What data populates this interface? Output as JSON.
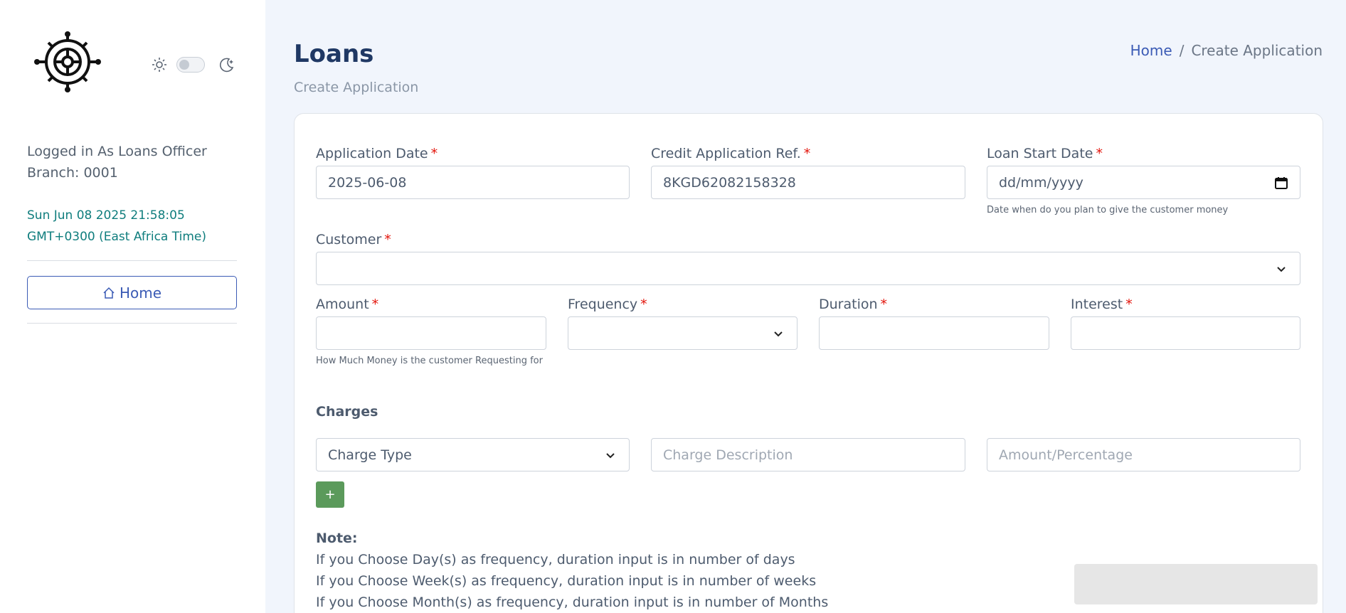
{
  "sidebar": {
    "user_line": "Logged in As Loans Officer",
    "branch_line": "Branch: 0001",
    "clock_line1": "Sun Jun 08 2025 21:58:05",
    "clock_line2": "GMT+0300 (East Africa Time)",
    "home_label": "Home",
    "icons": {
      "logo": "ship-wheel-logo",
      "sun": "sun-icon",
      "moon": "moon-icon",
      "home": "home-icon"
    },
    "theme_toggle": "off"
  },
  "header": {
    "title": "Loans",
    "subtitle": "Create Application",
    "breadcrumb": {
      "home": "Home",
      "separator": "/",
      "current": "Create Application"
    }
  },
  "form": {
    "application_date": {
      "label": "Application Date",
      "value": "2025-06-08"
    },
    "credit_ref": {
      "label": "Credit Application Ref.",
      "value": "8KGD62082158328"
    },
    "loan_start_date": {
      "label": "Loan Start Date",
      "placeholder": "dd/mm/yyyy",
      "hint": "Date when do you plan to give the customer money"
    },
    "customer": {
      "label": "Customer",
      "value": ""
    },
    "amount": {
      "label": "Amount",
      "value": "",
      "hint": "How Much Money is the customer Requesting for"
    },
    "frequency": {
      "label": "Frequency",
      "value": ""
    },
    "duration": {
      "label": "Duration",
      "value": ""
    },
    "interest": {
      "label": "Interest",
      "value": ""
    },
    "required_marker": "*"
  },
  "charges": {
    "title": "Charges",
    "charge_type": "Charge Type",
    "description_placeholder": "Charge Description",
    "amount_placeholder": "Amount/Percentage",
    "add_label": "+"
  },
  "note": {
    "title": "Note:",
    "lines": [
      "If you Choose Day(s) as frequency, duration input is in number of days",
      "If you Choose Week(s) as frequency, duration input is in number of weeks",
      "If you Choose Month(s) as frequency, duration input is in number of Months"
    ]
  },
  "colors": {
    "accent": "#3b5bb5",
    "title": "#1f3864",
    "required": "#e3140b",
    "clock": "#0f7d7d",
    "add_button": "#5b9a5b",
    "background": "#f1f5fc"
  }
}
